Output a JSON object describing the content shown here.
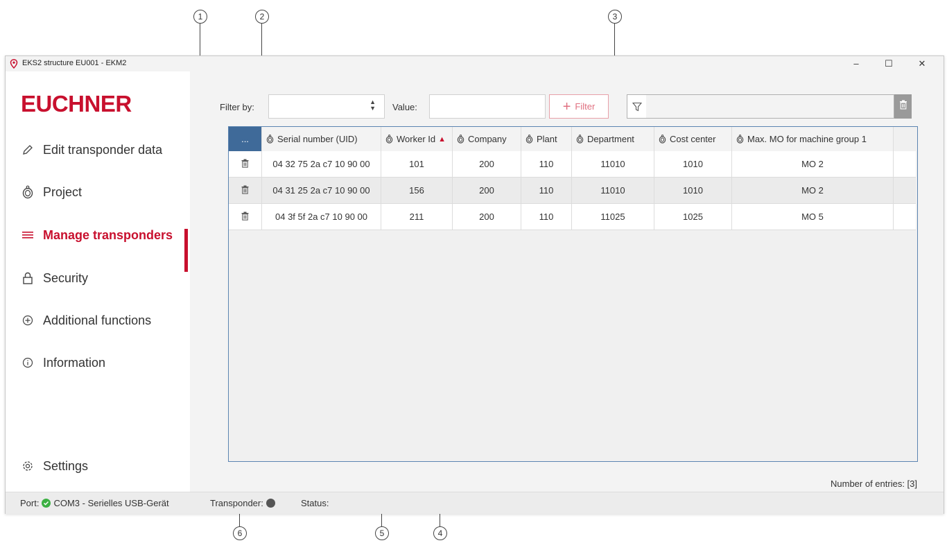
{
  "window": {
    "title": "EKS2 structure EU001 - EKM2",
    "minimize": "–",
    "maximize": "☐",
    "close": "✕"
  },
  "callouts": [
    "1",
    "2",
    "3",
    "4",
    "5",
    "6"
  ],
  "sidebar": {
    "logo": "EUCHNER",
    "items": [
      {
        "label": "Edit transponder data",
        "icon": "pencil-icon"
      },
      {
        "label": "Project",
        "icon": "transponder-icon"
      },
      {
        "label": "Manage transponders",
        "icon": "list-icon",
        "active": true
      },
      {
        "label": "Security",
        "icon": "lock-icon"
      },
      {
        "label": "Additional functions",
        "icon": "plus-circle-icon"
      },
      {
        "label": "Information",
        "icon": "info-icon"
      },
      {
        "label": "Settings",
        "icon": "gear-icon"
      }
    ]
  },
  "filter": {
    "filter_by_label": "Filter by:",
    "filter_by_value": "",
    "value_label": "Value:",
    "value_text": "",
    "add_button": "Filter",
    "active_filter": ""
  },
  "table": {
    "menu_label": "...",
    "columns": [
      "Serial number (UID)",
      "Worker Id",
      "Company",
      "Plant",
      "Department",
      "Cost center",
      "Max. MO for machine group 1"
    ],
    "sort_column": "Worker Id",
    "sort_direction": "ascending",
    "rows": [
      [
        "04 32 75 2a c7 10 90 00",
        "101",
        "200",
        "110",
        "11010",
        "1010",
        "MO 2"
      ],
      [
        "04 31 25 2a c7 10 90 00",
        "156",
        "200",
        "110",
        "11010",
        "1010",
        "MO 2"
      ],
      [
        "04 3f 5f 2a c7 10 90 00",
        "211",
        "200",
        "110",
        "11025",
        "1025",
        "MO 5"
      ]
    ],
    "entries_text": "Number of entries: [3]"
  },
  "statusbar": {
    "port_label": "Port:",
    "port_value": "COM3 - Serielles USB-Gerät",
    "transponder_label": "Transponder:",
    "status_label": "Status:",
    "status_value": ""
  },
  "colors": {
    "accent": "#c8102e",
    "grid_border": "#5b84b1",
    "port_ok": "#3cb043",
    "transponder_dot": "#555555"
  }
}
